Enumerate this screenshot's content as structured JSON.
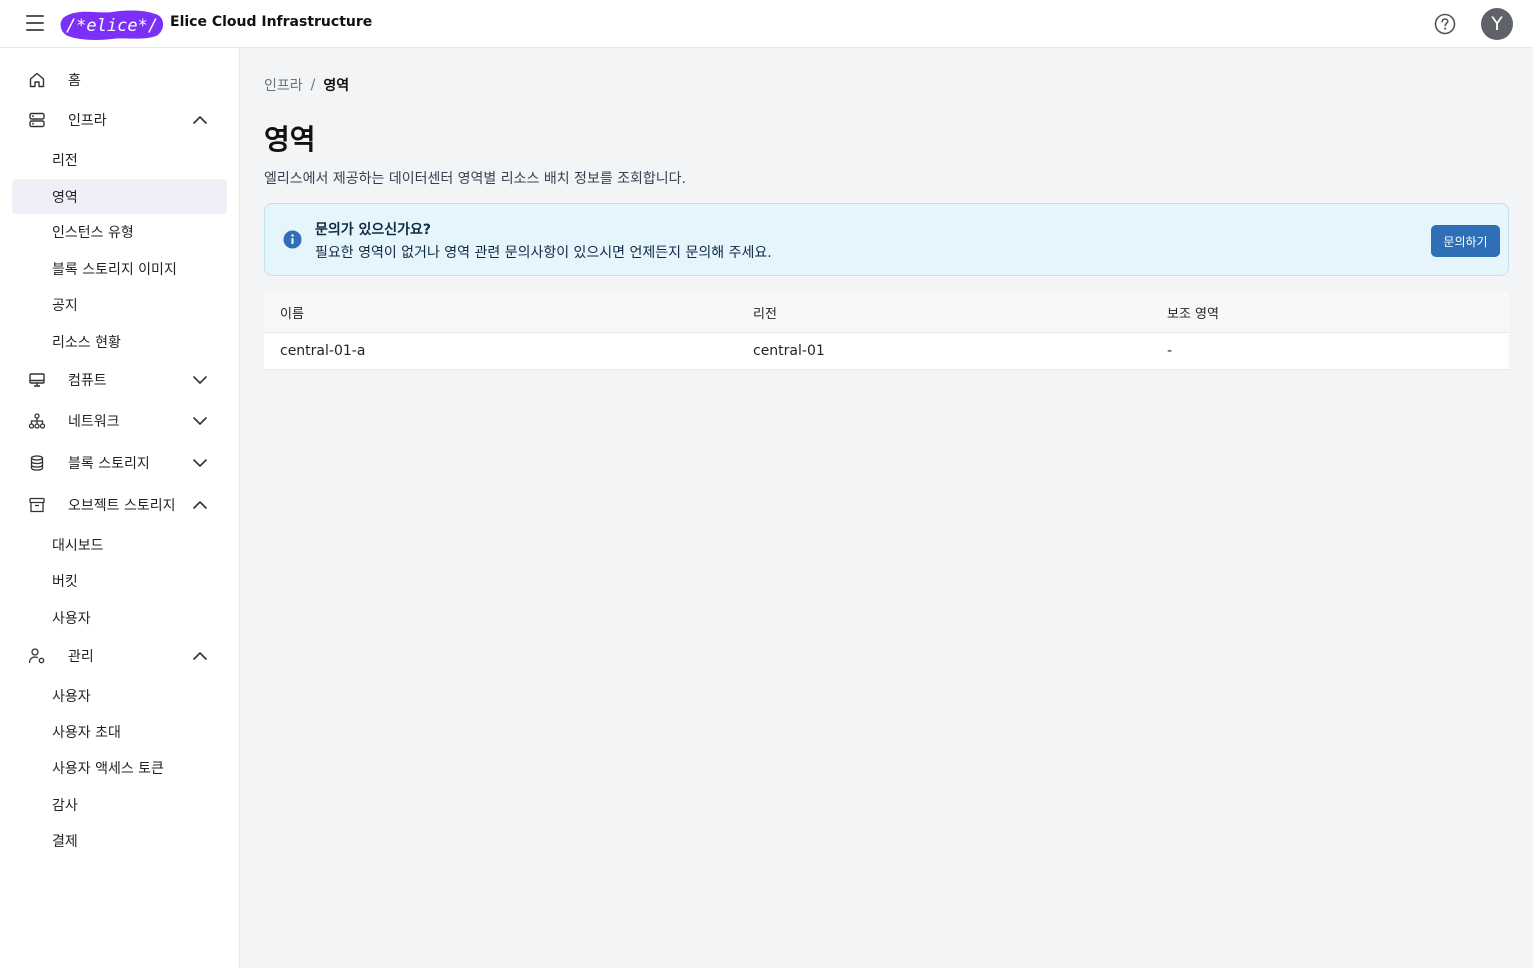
{
  "header": {
    "logo_text": "/*elice*/",
    "app_title": "Elice Cloud Infrastructure",
    "avatar_initial": "Y"
  },
  "sidebar": {
    "home": "홈",
    "infra": {
      "label": "인프라",
      "items": [
        "리전",
        "영역",
        "인스턴스 유형",
        "블록 스토리지 이미지",
        "공지",
        "리소스 현황"
      ]
    },
    "compute": {
      "label": "컴퓨트"
    },
    "network": {
      "label": "네트워크"
    },
    "block_storage": {
      "label": "블록 스토리지"
    },
    "object_storage": {
      "label": "오브젝트 스토리지",
      "items": [
        "대시보드",
        "버킷",
        "사용자"
      ]
    },
    "admin": {
      "label": "관리",
      "items": [
        "사용자",
        "사용자 초대",
        "사용자 액세스 토큰",
        "감사",
        "결제"
      ]
    }
  },
  "breadcrumb": {
    "parent": "인프라",
    "separator": "/",
    "current": "영역"
  },
  "page": {
    "title": "영역",
    "description": "엘리스에서 제공하는 데이터센터 영역별 리소스 배치 정보를 조회합니다."
  },
  "info": {
    "title": "문의가 있으신가요?",
    "text": "필요한 영역이 없거나 영역 관련 문의사항이 있으시면 언제든지 문의해 주세요.",
    "button": "문의하기"
  },
  "table": {
    "headers": [
      "이름",
      "리전",
      "보조 영역"
    ],
    "rows": [
      [
        "central-01-a",
        "central-01",
        "-"
      ]
    ]
  }
}
